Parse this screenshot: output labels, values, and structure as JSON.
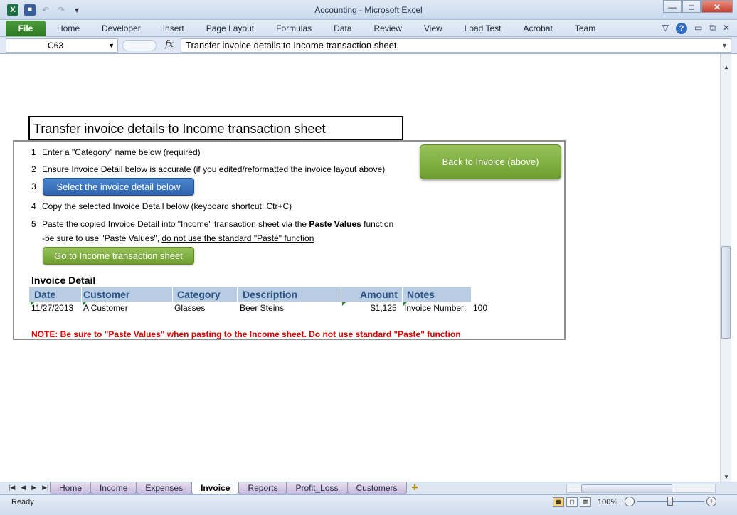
{
  "window": {
    "title": "Accounting  -  Microsoft Excel",
    "app_icon_letter": "X",
    "controls": {
      "minimize": "—",
      "maximize": "□",
      "close": "✕"
    }
  },
  "ribbon": {
    "file_tab": "File",
    "tabs": [
      "Home",
      "Developer",
      "Insert",
      "Page Layout",
      "Formulas",
      "Data",
      "Review",
      "View",
      "Load Test",
      "Acrobat",
      "Team"
    ]
  },
  "formula_bar": {
    "name_box": "C63",
    "fx_label": "fx",
    "content": "Transfer invoice details to Income transaction sheet"
  },
  "sheet": {
    "heading": "Transfer invoice details to Income transaction sheet",
    "steps": {
      "s1_num": "1",
      "s1_text": "Enter a \"Category\" name below (required)",
      "s2_num": "2",
      "s2_text": "Ensure Invoice Detail below is accurate (if you edited/reformatted the invoice layout above)",
      "s3_num": "3",
      "s4_num": "4",
      "s4_text": "Copy the selected Invoice Detail below (keyboard shortcut: Ctr+C)",
      "s5_num": "5",
      "s5_text_a": "Paste the copied Invoice Detail into \"Income\" transaction sheet via the ",
      "s5_bold": "Paste Values",
      "s5_text_b": " function",
      "s5_line2_a": "-be sure to use \"Paste Values\", ",
      "s5_line2_u": "do not use the standard \"Paste\" function"
    },
    "buttons": {
      "select_detail": "Select the invoice detail below",
      "go_income": "Go to Income transaction sheet",
      "back_invoice": "Back to Invoice (above)"
    },
    "invoice_detail": {
      "title": "Invoice Detail",
      "columns": [
        "Date",
        "Customer",
        "Category",
        "Description",
        "Amount",
        "Notes"
      ],
      "row": {
        "date": "11/27/2013",
        "customer": "A Customer",
        "category": "Glasses",
        "description": "Beer Steins",
        "amount": "$1,125",
        "notes": "Invoice Number:",
        "notes_value": "100"
      }
    },
    "note": "NOTE: Be sure to \"Paste Values\" when pasting to the Income sheet.  Do not use standard \"Paste\" function"
  },
  "sheet_tabs": {
    "tabs": [
      "Home",
      "Income",
      "Expenses",
      "Invoice",
      "Reports",
      "Profit_Loss",
      "Customers"
    ],
    "active": "Invoice"
  },
  "status_bar": {
    "status": "Ready",
    "zoom": "100%"
  }
}
